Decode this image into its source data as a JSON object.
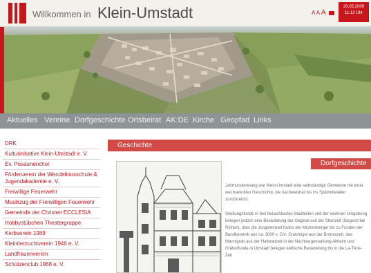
{
  "header": {
    "welcome": "Willkommen in",
    "city": "Klein-Umstadt",
    "font_size_controls": [
      "A",
      "A",
      "A"
    ],
    "date": "20.05.2009",
    "time": "11:12 Uhr"
  },
  "nav": {
    "items": [
      "Aktuelles",
      "Vereine",
      "Dorfgeschichte",
      "Ortsbeirat",
      "AK:DE",
      "Kirche",
      "Geopfad",
      "Links"
    ]
  },
  "sidebar": {
    "items": [
      "DRK",
      "Kulturinitiative Klein-Umstadt e. V.",
      "Ev. Posaunenchor",
      "Förderverein der Wendelinusschule & Jugendakademie e. V.",
      "Freiwillige Feuerwehr",
      "Musikzug der Freiwilligen Feuerwehr",
      "Gemeinde der Christen ECCLESIA",
      "Hobbystübchen Theatergruppe",
      "Kerbverein 1989",
      "Kleintierzuchtverein 1946 e. V.",
      "Landfrauenverein",
      "Schützenclub 1968 e. V."
    ]
  },
  "main": {
    "section_title": "Geschichte",
    "badge": "Dorfgeschichte",
    "paragraphs": [
      "Jahrhundertelang war Klein-Umstadt eine selbständige Gemeinde mit einer wechselvollen Geschichte, die nachweisbar bis ins Spätmittelalter zurückreicht.",
      "Siedlungsfunde in den benachbarten Stadtteilen und der weiteren Umgebung belegen jedoch eine Besiedelung der Gegend seit der Steinzeit (Gegend bei Richen), über die Jungsteinzeit Kultur der Michelsberger bis zu Funden der Bandkeramik aus ca. 3000 v. Chr. Grabhügel aus der Bronzezeit, das Mannigrab aus der Hallstattzeit in der Nachbargemarkung Altheim und Gräberfunde in Umstadt belegen keltische Besiedelung bis in die La-Tène-Zeit"
    ]
  },
  "colors": {
    "brand_red": "#c8161d",
    "section_red": "#d14a45",
    "nav_gray": "#8e9396"
  }
}
